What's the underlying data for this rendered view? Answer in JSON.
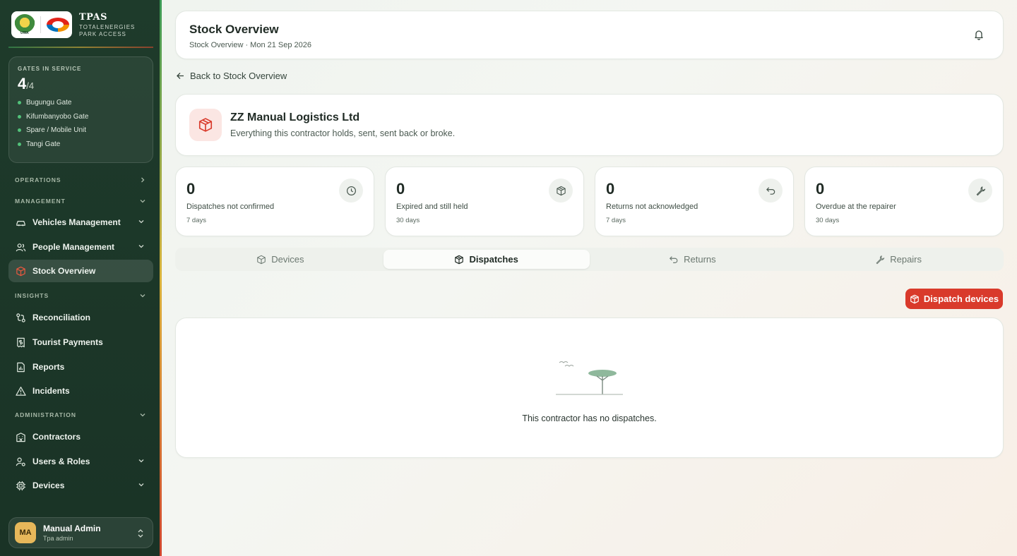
{
  "brand": {
    "title": "TPAS",
    "subtitle_line1": "TOTALENERGIES",
    "subtitle_line2": "PARK ACCESS",
    "uwa_logo_text": "UWA"
  },
  "gates": {
    "label": "GATES IN SERVICE",
    "count": "4",
    "total": "/4",
    "items": [
      "Bugungu Gate",
      "Kifumbanyobo Gate",
      "Spare / Mobile Unit",
      "Tangi Gate"
    ]
  },
  "nav": {
    "sections": {
      "operations": "OPERATIONS",
      "management": "MANAGEMENT",
      "insights": "INSIGHTS",
      "administration": "ADMINISTRATION"
    },
    "items": {
      "vehicles": "Vehicles Management",
      "people": "People Management",
      "stock": "Stock Overview",
      "reconciliation": "Reconciliation",
      "tourist_payments": "Tourist Payments",
      "reports": "Reports",
      "incidents": "Incidents",
      "contractors": "Contractors",
      "users_roles": "Users & Roles",
      "devices": "Devices"
    }
  },
  "user": {
    "initials": "MA",
    "name": "Manual Admin",
    "role": "Tpa admin"
  },
  "header": {
    "title": "Stock Overview",
    "subtitle": "Stock Overview · Mon 21 Sep 2026"
  },
  "back_link": "Back to Stock Overview",
  "contractor": {
    "name": "ZZ Manual Logistics Ltd",
    "description": "Everything this contractor holds, sent, sent back or broke."
  },
  "stats": [
    {
      "value": "0",
      "label": "Dispatches not confirmed",
      "period": "7 days",
      "icon": "clock-icon"
    },
    {
      "value": "0",
      "label": "Expired and still held",
      "period": "30 days",
      "icon": "package-icon"
    },
    {
      "value": "0",
      "label": "Returns not acknowledged",
      "period": "7 days",
      "icon": "undo-icon"
    },
    {
      "value": "0",
      "label": "Overdue at the repairer",
      "period": "30 days",
      "icon": "wrench-icon"
    }
  ],
  "tabs": [
    "Devices",
    "Dispatches",
    "Returns",
    "Repairs"
  ],
  "active_tab": "Dispatches",
  "dispatch_button": "Dispatch devices",
  "empty_message": "This contractor has no dispatches.",
  "colors": {
    "sidebar_bg": "#1e3b2b",
    "accent_red": "#d93a2b",
    "gate_online": "#52c27a",
    "avatar_bg": "#e7b75a"
  }
}
